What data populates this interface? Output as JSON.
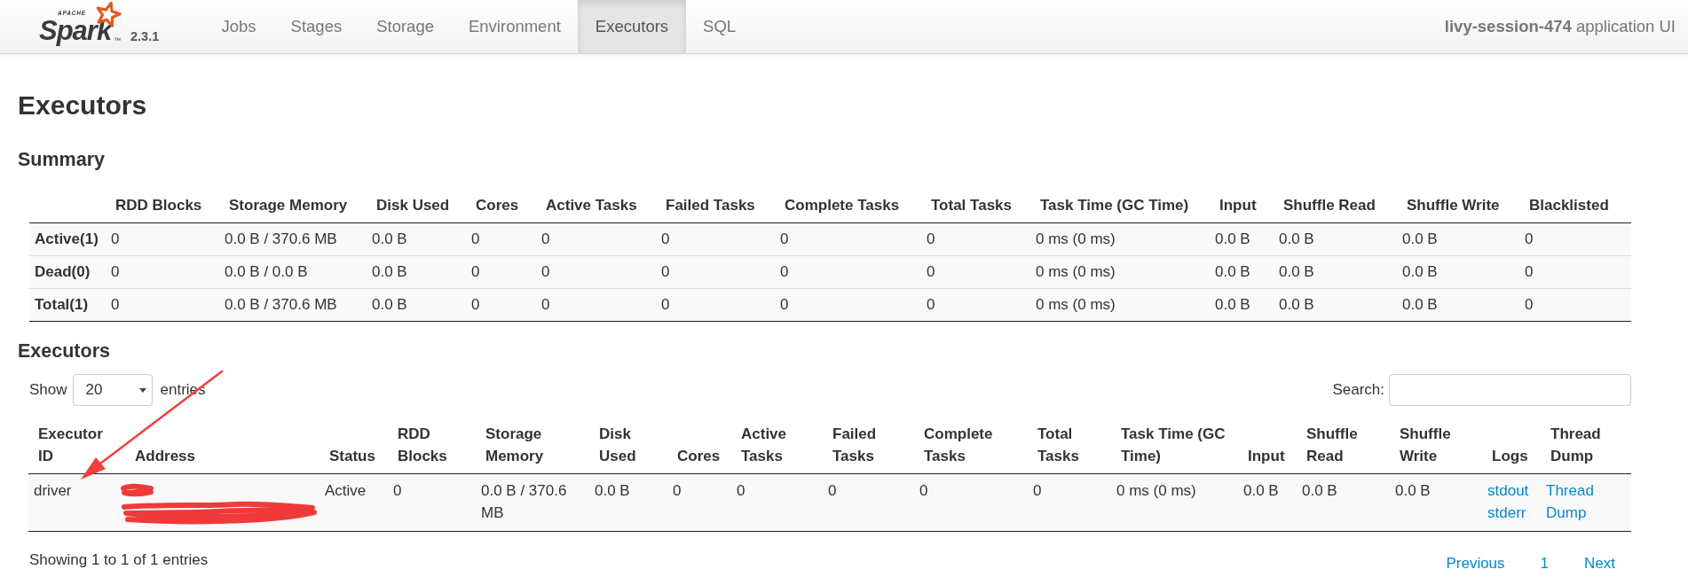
{
  "navbar": {
    "logo": {
      "caption": "APACHE",
      "name": "Spark",
      "trademark": "™",
      "version": "2.3.1"
    },
    "tabs": [
      {
        "label": "Jobs",
        "selected": false
      },
      {
        "label": "Stages",
        "selected": false
      },
      {
        "label": "Storage",
        "selected": false
      },
      {
        "label": "Environment",
        "selected": false
      },
      {
        "label": "Executors",
        "selected": true
      },
      {
        "label": "SQL",
        "selected": false
      }
    ],
    "app_title": "**livy-session-474** application UI"
  },
  "page_title": "Executors",
  "summary": {
    "title": "Summary",
    "columns": [
      "RDD Blocks",
      "Storage Memory",
      "Disk Used",
      "Cores",
      "Active Tasks",
      "Failed Tasks",
      "Complete Tasks",
      "Total Tasks",
      "Task Time (GC Time)",
      "Input",
      "Shuffle Read",
      "Shuffle Write",
      "Blacklisted"
    ],
    "rows": [
      {
        "label": "Active(1)",
        "cells": [
          "0",
          "0.0 B / 370.6 MB",
          "0.0 B",
          "0",
          "0",
          "0",
          "0",
          "0",
          "0 ms (0 ms)",
          "0.0 B",
          "0.0 B",
          "0.0 B",
          "0"
        ]
      },
      {
        "label": "Dead(0)",
        "cells": [
          "0",
          "0.0 B / 0.0 B",
          "0.0 B",
          "0",
          "0",
          "0",
          "0",
          "0",
          "0 ms (0 ms)",
          "0.0 B",
          "0.0 B",
          "0.0 B",
          "0"
        ]
      },
      {
        "label": "Total(1)",
        "cells": [
          "0",
          "0.0 B / 370.6 MB",
          "0.0 B",
          "0",
          "0",
          "0",
          "0",
          "0",
          "0 ms (0 ms)",
          "0.0 B",
          "0.0 B",
          "0.0 B",
          "0"
        ]
      }
    ]
  },
  "executors": {
    "title": "Executors",
    "length_menu": {
      "before": "Show",
      "value": "20",
      "after": "entries"
    },
    "search": {
      "label": "Search:"
    },
    "columns": [
      "Executor ID",
      "Address",
      "Status",
      "RDD Blocks",
      "Storage Memory",
      "Disk Used",
      "Cores",
      "Active Tasks",
      "Failed Tasks",
      "Complete Tasks",
      "Total Tasks",
      "Task Time (GC Time)",
      "Input",
      "Shuffle Read",
      "Shuffle Write",
      "Logs",
      "Thread Dump"
    ],
    "rows": [
      {
        "cells": [
          {
            "kind": "text",
            "text": "driver"
          },
          {
            "kind": "redacted"
          },
          {
            "kind": "text",
            "text": "Active"
          },
          {
            "kind": "text",
            "text": "0"
          },
          {
            "kind": "text",
            "text": "0.0 B / 370.6 MB"
          },
          {
            "kind": "text",
            "text": "0.0 B"
          },
          {
            "kind": "text",
            "text": "0"
          },
          {
            "kind": "text",
            "text": "0"
          },
          {
            "kind": "text",
            "text": "0"
          },
          {
            "kind": "text",
            "text": "0"
          },
          {
            "kind": "text",
            "text": "0"
          },
          {
            "kind": "text",
            "text": "0 ms (0 ms)"
          },
          {
            "kind": "text",
            "text": "0.0 B"
          },
          {
            "kind": "text",
            "text": "0.0 B"
          },
          {
            "kind": "text",
            "text": "0.0 B"
          },
          {
            "kind": "links",
            "links": [
              "stdout",
              "stderr"
            ]
          },
          {
            "kind": "link",
            "text": "Thread Dump"
          }
        ]
      }
    ],
    "info": "Showing 1 to 1 of 1 entries",
    "pagination": {
      "previous": "Previous",
      "pages": [
        "1"
      ],
      "next": "Next"
    }
  }
}
